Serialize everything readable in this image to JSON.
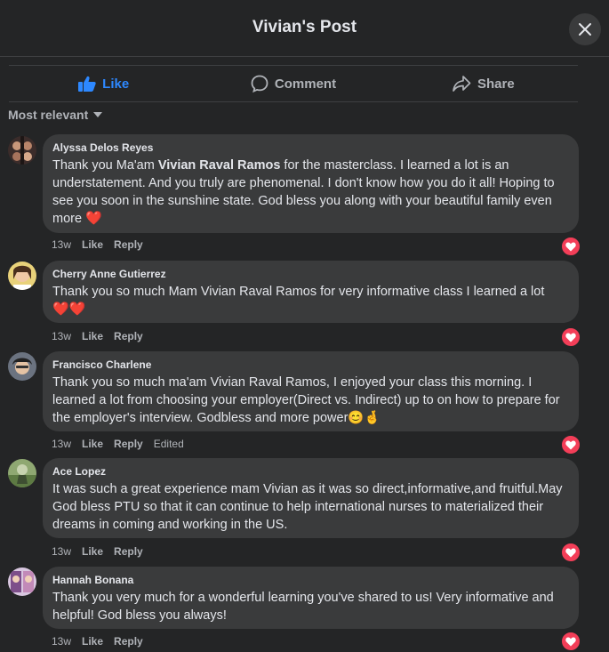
{
  "header": {
    "title": "Vivian's Post"
  },
  "actions": {
    "like": "Like",
    "comment": "Comment",
    "share": "Share"
  },
  "sort": {
    "label": "Most relevant"
  },
  "comments": [
    {
      "author": "Alyssa Delos Reyes",
      "text_pre": "Thank you Ma'am ",
      "mention": "Vivian Raval Ramos",
      "text_post": " for the masterclass. I learned a lot is an understatement. And you truly are phenomenal. I don't know how you do it all! Hoping to see you soon in the sunshine state. God bless you along with your beautiful family even more",
      "emoji": "❤️",
      "time": "13w",
      "like": "Like",
      "reply": "Reply"
    },
    {
      "author": "Cherry Anne Gutierrez",
      "text": "Thank you so much Mam Vivian Raval Ramos for very informative class I learned a lot",
      "emoji": "❤️❤️",
      "time": "13w",
      "like": "Like",
      "reply": "Reply"
    },
    {
      "author": "Francisco Charlene",
      "text": "Thank you so much ma'am Vivian Raval Ramos, I enjoyed your class this morning. I learned a lot from choosing your employer(Direct vs. Indirect) up to on how to prepare for the employer's interview. Godbless and more power",
      "emoji": "😊🤞",
      "time": "13w",
      "like": "Like",
      "reply": "Reply",
      "edited": "Edited"
    },
    {
      "author": "Ace Lopez",
      "text": "It was such a great experience mam Vivian as it was so direct,informative,and fruitful.May God bless PTU so that it can continue to help international nurses to materialized their dreams in coming and working in the US.",
      "time": "13w",
      "like": "Like",
      "reply": "Reply"
    },
    {
      "author": "Hannah Bonana",
      "text": "Thank you very much for a wonderful learning you've shared to us! Very informative and helpful! God bless you always!",
      "time": "13w",
      "like": "Like",
      "reply": "Reply"
    }
  ],
  "colors": {
    "accent": "#2d88ff",
    "heart": "#f33e58",
    "bubble": "#3a3b3c",
    "background": "#242526"
  }
}
